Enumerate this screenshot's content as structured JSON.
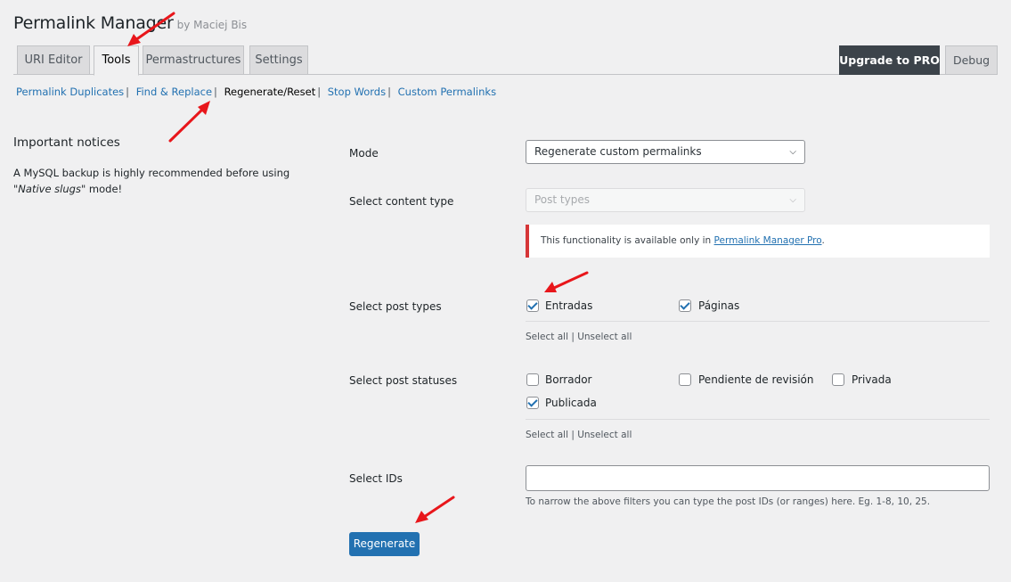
{
  "header": {
    "title": "Permalink Manager",
    "byline": "by Maciej Bis"
  },
  "tabs": [
    {
      "label": "URI Editor"
    },
    {
      "label": "Tools",
      "active": true
    },
    {
      "label": "Permastructures"
    },
    {
      "label": "Settings"
    }
  ],
  "header_buttons": {
    "upgrade": "Upgrade to PRO",
    "debug": "Debug"
  },
  "subnav": [
    {
      "label": "Permalink Duplicates"
    },
    {
      "label": "Find & Replace"
    },
    {
      "label": "Regenerate/Reset",
      "current": true
    },
    {
      "label": "Stop Words"
    },
    {
      "label": "Custom Permalinks"
    }
  ],
  "subnav_separator": "|",
  "notices": {
    "heading": "Important notices",
    "text_before": "A MySQL backup is highly recommended before using \"",
    "text_em": "Native slugs",
    "text_after": "\" mode!"
  },
  "form": {
    "mode": {
      "label": "Mode",
      "value": "Regenerate custom permalinks"
    },
    "content_type": {
      "label": "Select content type",
      "value": "Post types",
      "disabled": true
    },
    "pro_notice": {
      "text": "This functionality is available only in ",
      "link": "Permalink Manager Pro",
      "tail": "."
    },
    "post_types": {
      "label": "Select post types",
      "options": [
        {
          "label": "Entradas",
          "checked": true
        },
        {
          "label": "Páginas",
          "checked": true
        }
      ]
    },
    "post_statuses": {
      "label": "Select post statuses",
      "options": [
        {
          "label": "Borrador",
          "checked": false
        },
        {
          "label": "Pendiente de revisión",
          "checked": false
        },
        {
          "label": "Privada",
          "checked": false
        },
        {
          "label": "Publicada",
          "checked": true
        }
      ]
    },
    "select_all": "Select all",
    "unselect_all": "Unselect all",
    "ids": {
      "label": "Select IDs",
      "value": "",
      "hint": "To narrow the above filters you can type the post IDs (or ranges) here. Eg. 1-8, 10, 25."
    },
    "submit": "Regenerate"
  },
  "colors": {
    "accent": "#2271b1",
    "annotation_arrow": "#e8161b",
    "pro_button": "#3c434a",
    "notice_border": "#d63638"
  }
}
